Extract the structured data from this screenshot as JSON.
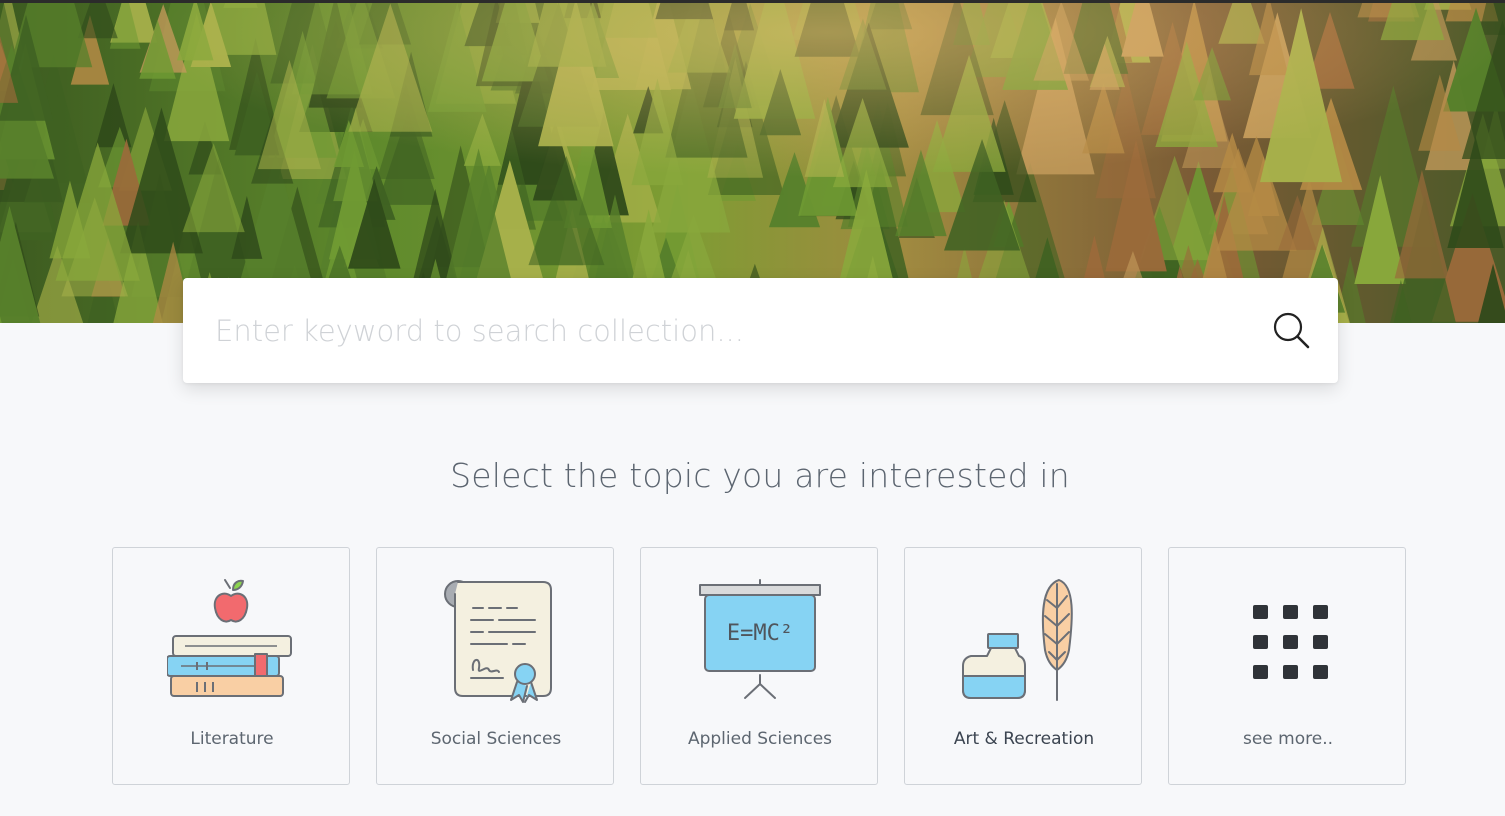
{
  "search": {
    "placeholder": "Enter keyword to search collection...",
    "value": ""
  },
  "section": {
    "title": "Select the topic you are interested in"
  },
  "topics": [
    {
      "label": "Literature",
      "icon": "books-apple-icon"
    },
    {
      "label": "Social Sciences",
      "icon": "certificate-scroll-icon"
    },
    {
      "label": "Applied Sciences",
      "icon": "blackboard-emc2-icon"
    },
    {
      "label": "Art & Recreation",
      "icon": "ink-quill-icon"
    },
    {
      "label": "see more..",
      "icon": "grid-icon"
    }
  ],
  "blackboard_text": "E=MC²",
  "colors": {
    "page_bg": "#f7f8fa",
    "card_border": "#cfd3d8",
    "light_blue": "#86d3f3",
    "peach": "#f9cfa4",
    "cream": "#f4f0e0",
    "apple_red": "#f26a6e",
    "icon_stroke": "#6b6f76",
    "grid_dark": "#2f3338"
  }
}
